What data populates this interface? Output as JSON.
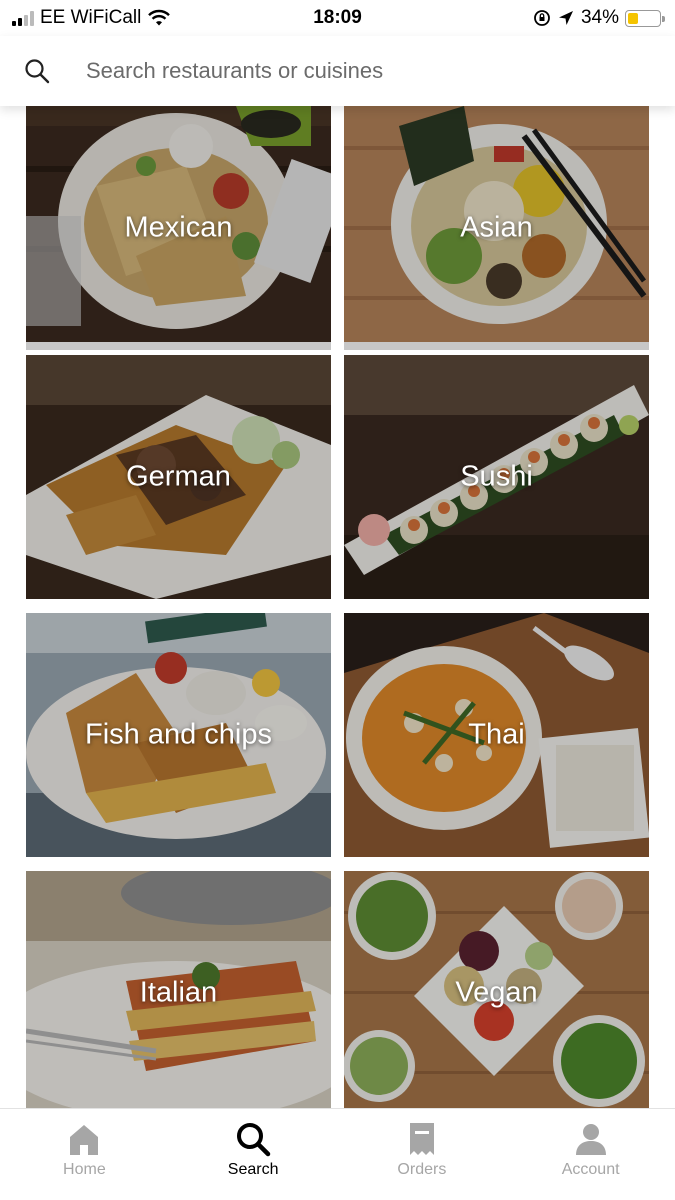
{
  "status_bar": {
    "carrier": "EE WiFiCall",
    "time": "18:09",
    "battery": "34%",
    "battery_level": 0.34
  },
  "search": {
    "placeholder": "Search restaurants or cuisines",
    "icon": "search-icon"
  },
  "cuisines": [
    {
      "label": "Mexican"
    },
    {
      "label": "Asian"
    },
    {
      "label": "German"
    },
    {
      "label": "Sushi"
    },
    {
      "label": "Fish and chips"
    },
    {
      "label": "Thai"
    },
    {
      "label": "Italian"
    },
    {
      "label": "Vegan"
    }
  ],
  "tab_bar": {
    "items": [
      {
        "label": "Home",
        "icon": "home-icon",
        "active": false
      },
      {
        "label": "Search",
        "icon": "search-icon",
        "active": true
      },
      {
        "label": "Orders",
        "icon": "receipt-icon",
        "active": false
      },
      {
        "label": "Account",
        "icon": "person-icon",
        "active": false
      }
    ]
  },
  "colors": {
    "active_tab": "#000000",
    "inactive_tab": "#a6a6a6",
    "battery_fill": "#f5c400"
  }
}
